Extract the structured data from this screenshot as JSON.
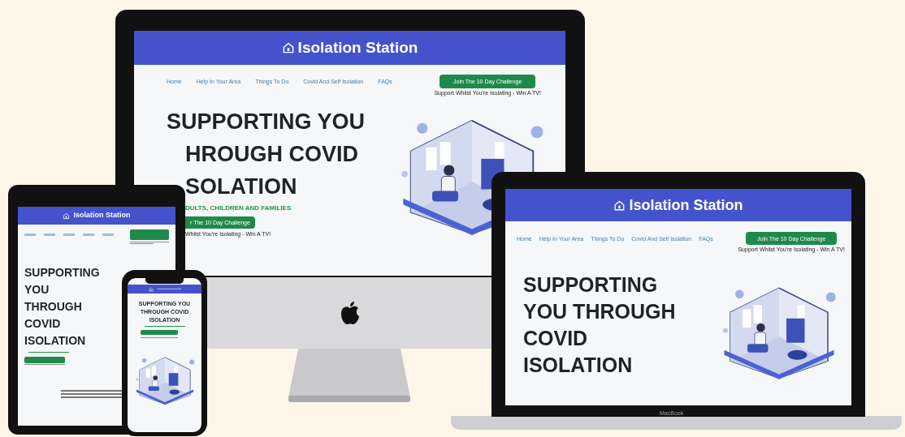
{
  "devices": [
    {
      "kind": "tablet",
      "site": {
        "brand": "Isolation Station",
        "headline": [
          "SUPPORTING",
          "YOU",
          "THROUGH",
          "COVID",
          "ISOLATION"
        ]
      }
    },
    {
      "kind": "desktop",
      "site": {
        "brand": "Isolation Station",
        "nav": [
          "Home",
          "Help In Your Area",
          "Things To Do",
          "Covid And Self Isolation",
          "FAQs"
        ],
        "cta": "Join The 10 Day Challenge",
        "cta_note": "Support Whilst You're Isolating - Win A TV!",
        "headline": [
          "SUPPORTING YOU",
          "HROUGH COVID",
          "SOLATION"
        ],
        "tagline": "DULTS, CHILDREN AND FAMILIES",
        "hero_button": "r The 10 Day Challenge",
        "hero_note": "Whilst You're Isolating - Win A TV!"
      }
    },
    {
      "kind": "phone",
      "site": {
        "headline": [
          "SUPPORTING YOU",
          "THROUGH COVID",
          "ISOLATION"
        ]
      }
    },
    {
      "kind": "laptop",
      "label": "MacBook",
      "site": {
        "brand": "Isolation Station",
        "nav": [
          "Home",
          "Help In Your Area",
          "Things To Do",
          "Covid And Self Isolation",
          "FAQs"
        ],
        "cta": "Join The 10 Day Challenge",
        "cta_note": "Support Whilst You're Isolating - Win A TV!",
        "headline": [
          "SUPPORTING",
          "YOU THROUGH",
          "COVID",
          "ISOLATION"
        ]
      }
    }
  ]
}
